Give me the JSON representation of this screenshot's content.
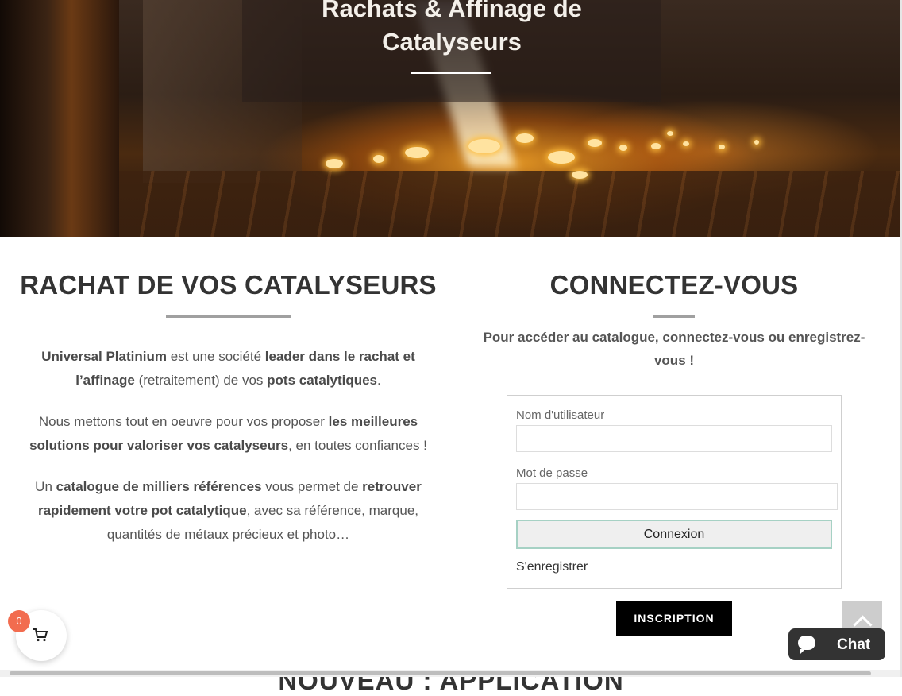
{
  "hero": {
    "title_line1": "Rachats & Affinage de",
    "title_line2": "Catalyseurs"
  },
  "left": {
    "title": "RACHAT DE VOS CATALYSEURS",
    "p1": {
      "a": "Universal Platinium",
      "b": " est une société ",
      "c": "leader dans le rachat et l’affinage",
      "d": " (retraitement) de vos ",
      "e": "pots catalytiques",
      "f": "."
    },
    "p2": {
      "a": "Nous mettons tout en oeuvre pour vos proposer ",
      "b": "les meilleures solutions pour valoriser vos catalyseurs",
      "c": ", en toutes confiances !"
    },
    "p3": {
      "a": "Un ",
      "b": "catalogue de milliers références",
      "c": " vous permet de ",
      "d": "retrouver rapidement votre pot catalytique",
      "e": ", avec sa référence, marque, quantités de métaux précieux et photo…"
    }
  },
  "right": {
    "title": "CONNECTEZ-VOUS",
    "subtitle": "Pour accéder au catalogue, connectez-vous ou enregistrez-vous !",
    "username_label": "Nom d'utilisateur",
    "password_label": "Mot de passe",
    "username_value": "",
    "password_value": "",
    "login_button": "Connexion",
    "register_link": "S'enregistrer",
    "signup_button": "INSCRIPTION"
  },
  "floating": {
    "chat_label": "Chat",
    "cart_count": "0",
    "cart_icon": "cart-icon",
    "chat_icon": "chat-bubble-icon",
    "back_to_top_icon": "chevron-up-icon"
  },
  "next_section_title": "NOUVEAU : APPLICATION",
  "colors": {
    "badge": "#f26c4f",
    "button_dark": "#000000",
    "chat_bg": "#333333",
    "login_border": "#a6d1c4"
  }
}
